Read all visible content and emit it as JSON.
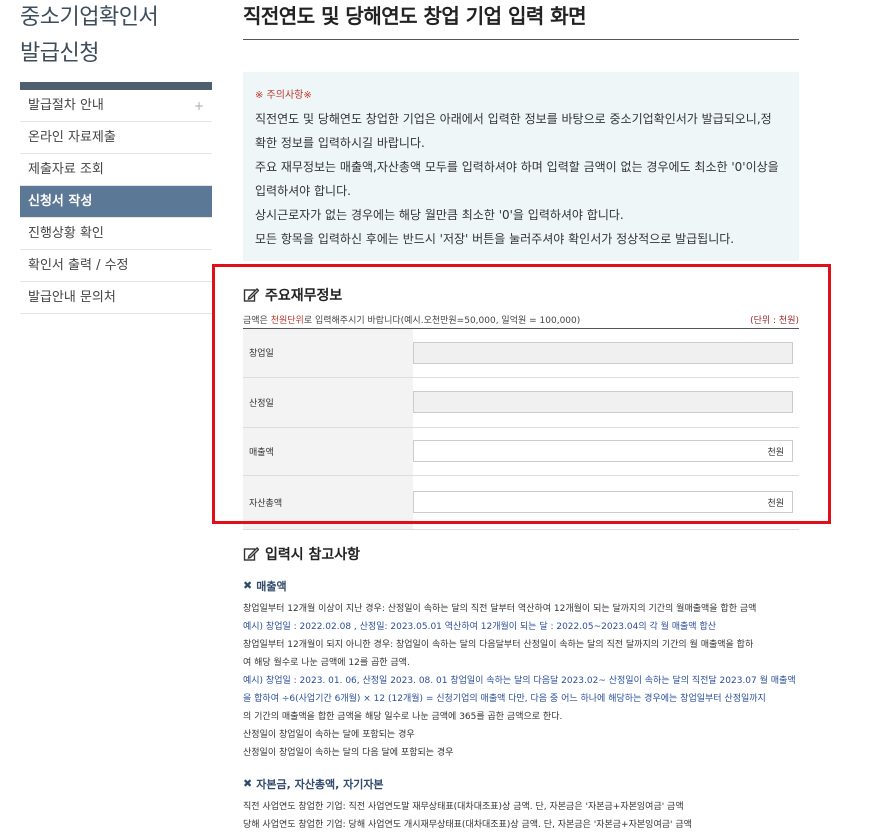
{
  "sidebar": {
    "title_line1": "중소기업확인서",
    "title_line2": "발급신청",
    "plus": "+",
    "items": [
      {
        "label": "발급절차 안내"
      },
      {
        "label": "온라인 자료제출"
      },
      {
        "label": "제출자료 조회"
      },
      {
        "label": "신청서 작성"
      },
      {
        "label": "진행상황 확인"
      },
      {
        "label": "확인서 출력 / 수정"
      },
      {
        "label": "발급안내 문의처"
      }
    ]
  },
  "main": {
    "title": "직전연도 및 당해연도 창업 기업 입력 화면",
    "notice": {
      "head": "※ 주의사항※",
      "lines": [
        "직전연도 및 당해연도 창업한 기업은 아래에서 입력한 정보를 바탕으로 중소기업확인서가 발급되오니,정",
        "확한 정보를 입력하시길 바랍니다.",
        "주요 재무정보는 매출액,자산총액 모두를 입력하셔야 하며 입력할 금액이 없는 경우에도 최소한 '0'이상을",
        "입력하셔야 합니다.",
        "상시근로자가 없는 경우에는 해당 월만큼 최소한 '0'을 입력하셔야 합니다.",
        "모든 항목을 입력하신 후에는 반드시 '저장' 버튼을 눌러주셔야 확인서가 정상적으로 발급됩니다."
      ]
    },
    "finance": {
      "title": "주요재무정보",
      "unit_prefix": "금액은 ",
      "unit_red": "천원단위",
      "unit_suffix": "로 입력해주시기 바랍니다(예시.오천만원=50,000, 일억원 = 100,000)",
      "unit_right": "(단위 : 천원)",
      "rows": [
        {
          "label": "창업일"
        },
        {
          "label": "산정일"
        },
        {
          "label": "매출액",
          "suffix": "천원"
        },
        {
          "label": "자산총액",
          "suffix": "천원"
        }
      ]
    },
    "reference": {
      "title": "입력시 참고사항",
      "sales": {
        "title": "매출액",
        "l1": "창업일부터 12개월 이상이 지난 경우: 산정일이 속하는 달의 직전 달부터 역산하여 12개월이 되는 달까지의 기간의 월매출액을 합한 금액",
        "l2": "예시) 창업일 : 2022.02.08 , 산정일: 2023.05.01 역산하여 12개월이 되는 달 : 2022.05~2023.04의 각 월 매출액 합산",
        "l3": "창업일부터 12개월이 되지 아니한 경우: 창업일이 속하는 달의 다음달부터 산정일이 속하는 달의 직전 달까지의 기간의 월 매출액을 합하",
        "l4": "여 해당 월수로 나눈 금액에 12를 곱한 금액.",
        "l5": "예시) 창업일 : 2023. 01. 06, 산정일 2023. 08. 01 창업일이 속하는 달의 다음달 2023.02~ 산정일이 속하는 달의 직전달 2023.07 월 매출액",
        "l6": "을 합하여 ÷6(사업기간 6개월) × 12 (12개월) = 신청기업의 매출액 다만, 다음 중 어느 하나에 해당하는 경우에는 창업일부터 산정일까지",
        "l7": "의 기간의 매출액을 합한 금액을 해당 일수로 나눈 금액에 365를 곱한 금액으로 한다.",
        "l8": "산정일이 창업일이 속하는 달에 포함되는 경우",
        "l9": "산정일이 창업일이 속하는 달의 다음 달에 포함되는 경우"
      },
      "capital": {
        "title": "자본금, 자산총액, 자기자본",
        "l1": "직전 사업연도 창업한 기업: 직전 사업연도말 재무상태표(대차대조표)상 금액. 단, 자본금은 '자본금+자본잉여금' 금액",
        "l2": "당해 사업연도 창업한 기업: 당해 사업연도 개시재무상태표(대차대조표)상 금액. 단, 자본금은 '자본금+자본잉여금' 금액"
      }
    }
  },
  "colors": {
    "sidebar_active": "#5b7896",
    "highlight_box": "#e0101a",
    "notice_bg": "#eef6f8"
  }
}
